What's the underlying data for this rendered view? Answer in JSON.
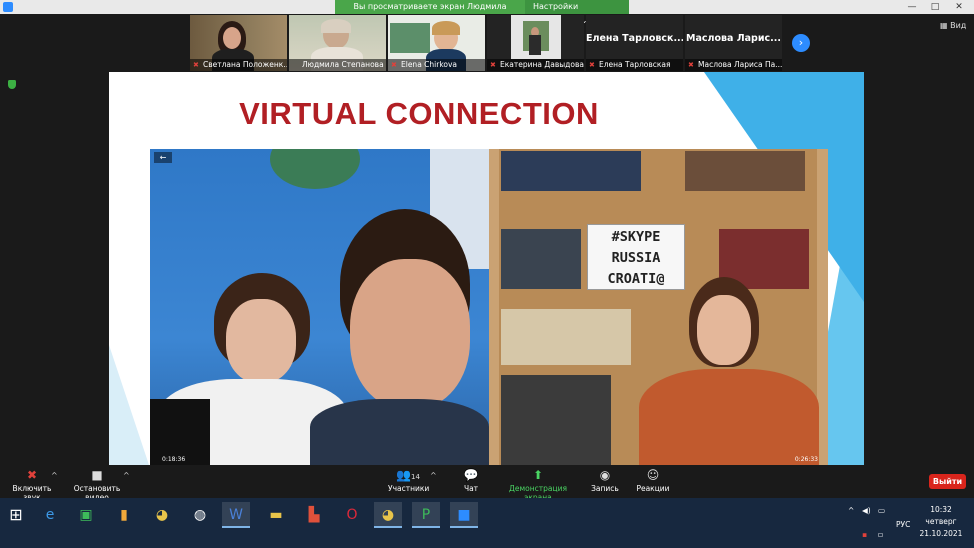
{
  "topbar": {
    "share_message": "Вы просматриваете экран Людмила Степанова",
    "view_settings": "Настройки просмотра",
    "view_settings_caret": "⌄",
    "minimize": "—",
    "maximize": "□",
    "close": "✕"
  },
  "participants": [
    {
      "name": "Светлана Положенк...",
      "muted": true
    },
    {
      "name": "Людмила Степанова",
      "muted": false,
      "active": true
    },
    {
      "name": "Elena Chirkova",
      "muted": true
    },
    {
      "name": "Екатерина Давыдова",
      "muted": true
    },
    {
      "name": "Елена Тарловская",
      "big_name": "Елена  Тарловск...",
      "muted": true
    },
    {
      "name": "Маслова Лариса Па...",
      "big_name": "Маслова  Ларис...",
      "muted": true
    }
  ],
  "view_label": "Вид",
  "next_arrow": "›",
  "slide": {
    "title": "VIRTUAL CONNECTION",
    "back_arrow": "←",
    "sign_lines": [
      "#SKYPE",
      "RUSSIA",
      "CROATI@"
    ],
    "time_left": "0:18:36",
    "time_right": "0:26:33"
  },
  "toolbar": {
    "unmute": "Включить звук",
    "stop_video": "Остановить видео",
    "participants_count": "14",
    "participants": "Участники",
    "chat": "Чат",
    "share_screen": "Демонстрация экрана",
    "record": "Запись",
    "reactions": "Реакции",
    "leave": "Выйти",
    "caret": "^"
  },
  "taskbar": {
    "lang": "РУС",
    "time": "10:32",
    "day": "четверг",
    "date": "21.10.2021"
  },
  "colors": {
    "slide_title": "#b11f24",
    "share_green": "#4aa64a",
    "leave_red": "#d9251c",
    "zoom_blue": "#2d8cff",
    "taskbar": "#17283f"
  }
}
